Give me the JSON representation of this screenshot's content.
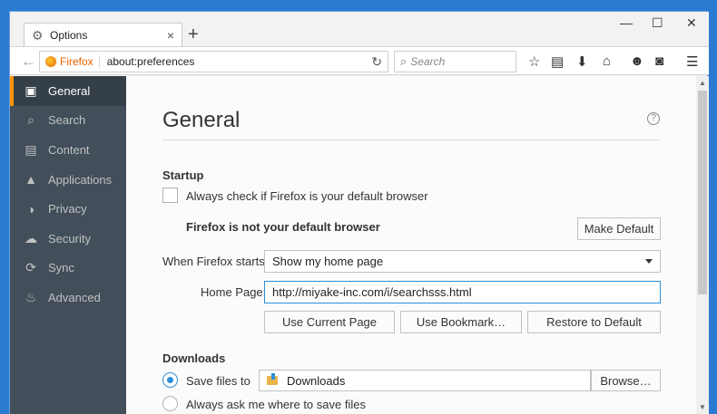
{
  "tab": {
    "title": "Options",
    "close": "×",
    "new": "+"
  },
  "window_controls": {
    "minimize": "—",
    "maximize": "☐",
    "close": "✕"
  },
  "nav": {
    "back": "←",
    "identity": "Firefox",
    "url": "about:preferences",
    "reload": "↻",
    "search_placeholder": "Search",
    "search_glyph": "⌕",
    "star": "☆",
    "library": "▤",
    "download": "⬇",
    "home": "⌂",
    "emoji": "☻",
    "pocket": "◙",
    "menu": "☰"
  },
  "sidebar": {
    "items": [
      {
        "label": "General",
        "icon": "general-icon",
        "glyph": "▣"
      },
      {
        "label": "Search",
        "icon": "search-icon",
        "glyph": "⌕"
      },
      {
        "label": "Content",
        "icon": "content-icon",
        "glyph": "▤"
      },
      {
        "label": "Applications",
        "icon": "applications-icon",
        "glyph": "▲"
      },
      {
        "label": "Privacy",
        "icon": "privacy-mask-icon",
        "glyph": "◑"
      },
      {
        "label": "Security",
        "icon": "security-icon",
        "glyph": "☁"
      },
      {
        "label": "Sync",
        "icon": "sync-icon",
        "glyph": "⟳"
      },
      {
        "label": "Advanced",
        "icon": "advanced-wizard-icon",
        "glyph": "♨"
      }
    ]
  },
  "general": {
    "title": "General",
    "help": "?",
    "startup": {
      "heading": "Startup",
      "default_check_label": "Always check if Firefox is your default browser",
      "default_status": "Firefox is not your default browser",
      "make_default_button": "Make Default",
      "when_starts_label": "When Firefox starts:",
      "when_starts_value": "Show my home page",
      "home_page_label": "Home Page:",
      "home_page_value": "http://miyake-inc.com/i/searchsss.html",
      "use_current_page_button": "Use Current Page",
      "use_bookmark_button": "Use Bookmark…",
      "restore_default_button": "Restore to Default"
    },
    "downloads": {
      "heading": "Downloads",
      "save_files_label": "Save files to",
      "save_folder": "Downloads",
      "browse_button": "Browse…",
      "always_ask_label": "Always ask me where to save files"
    }
  },
  "scrollbar": {
    "up": "▲",
    "down": "▼"
  },
  "colors": {
    "accent": "#ff9500",
    "sidebar_bg": "#424f5a",
    "focus_blue": "#2b8fdb",
    "firefox_orange": "#e66000"
  }
}
